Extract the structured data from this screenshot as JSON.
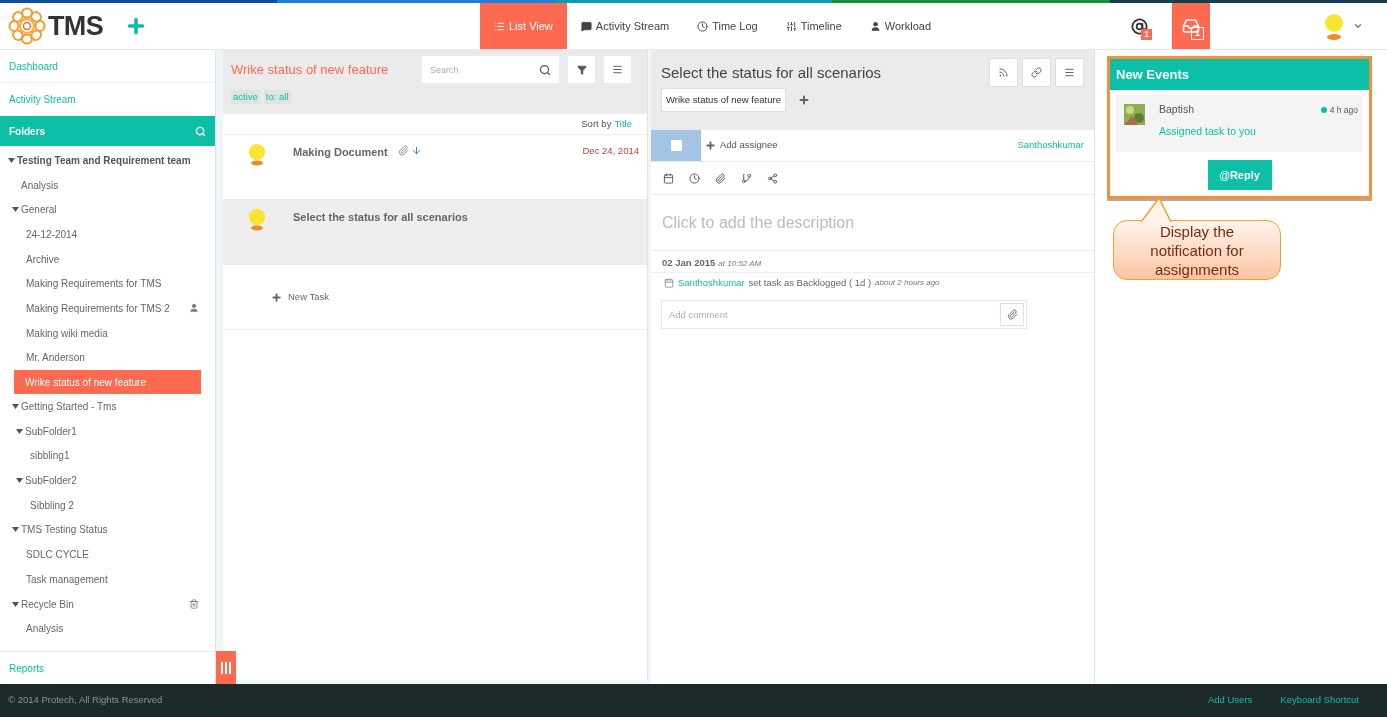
{
  "app": {
    "logo_text": "TMS"
  },
  "nav_tabs": [
    {
      "label": "List View",
      "kind": "list",
      "selected": true
    },
    {
      "label": "Activity Stream",
      "kind": "stream",
      "selected": false
    },
    {
      "label": "Time Log",
      "kind": "time",
      "selected": false
    },
    {
      "label": "Timeline",
      "kind": "timeline",
      "selected": false
    },
    {
      "label": "Workload",
      "kind": "workload",
      "selected": false
    }
  ],
  "notifications": [
    {
      "kind": "mention",
      "count": "1",
      "highlighted": false
    },
    {
      "kind": "inbox",
      "count": "1",
      "highlighted": true
    }
  ],
  "sidebar": {
    "links": [
      "Dashboard",
      "Activity Stream"
    ],
    "folders_title": "Folders",
    "footer_link": "Reports",
    "tree": [
      {
        "label": "Testing Team and Requirement team",
        "selected": false,
        "expanded": true,
        "children": [
          {
            "label": "Analysis",
            "selected": false
          },
          {
            "label": "General",
            "selected": false,
            "expanded": true,
            "children": [
              {
                "label": "24-12-2014",
                "selected": false
              },
              {
                "label": "Archive",
                "selected": false
              },
              {
                "label": "Making Requirements for TMS",
                "selected": false
              },
              {
                "label": "Making Requirements for TMS 2",
                "kind": "shared",
                "selected": false
              },
              {
                "label": "Making wiki media",
                "selected": false
              },
              {
                "label": "Mr. Anderson",
                "selected": false
              },
              {
                "label": "Wrike status of new feature",
                "selected": true
              }
            ]
          },
          {
            "label": "Getting Started - Tms",
            "selected": false,
            "expanded": true,
            "children": [
              {
                "label": "SubFolder1",
                "selected": false,
                "expanded": true,
                "children": [
                  {
                    "label": "sibbling1",
                    "selected": false
                  }
                ]
              },
              {
                "label": "SubFolder2",
                "selected": false,
                "expanded": true,
                "children": [
                  {
                    "label": "Sibbling 2",
                    "selected": false
                  }
                ]
              }
            ]
          },
          {
            "label": "TMS Testing Status",
            "selected": false,
            "expanded": true,
            "children": [
              {
                "label": "SDLC CYCLE",
                "selected": false
              },
              {
                "label": "Task management",
                "selected": false
              }
            ]
          },
          {
            "label": "Recycle Bin",
            "kind": "trash",
            "selected": false,
            "expanded": true,
            "children": [
              {
                "label": "Analysis",
                "selected": false
              }
            ]
          }
        ]
      }
    ]
  },
  "task_list": {
    "title": "Wrike status of new feature",
    "search": {
      "placeholder": "Search"
    },
    "filters": [
      "active",
      "to: all"
    ],
    "sort_label": "Sort by",
    "sort_value": "Title",
    "tasks": [
      {
        "title": "Making Document",
        "date": "Dec 24, 2014",
        "has_attachment": true,
        "selected": false
      },
      {
        "title": "Select the status for all scenarios",
        "has_attachment": false,
        "selected": true
      }
    ],
    "new_task": "New Task"
  },
  "task_detail": {
    "title": "Select the status for all scenarios",
    "folder_tag": "Wrike status of new feature",
    "checked": false,
    "assignee_action": "Add assignee",
    "owner": "Santhoshkumar",
    "description_placeholder": "Click to add the description",
    "log": {
      "date": "02 Jan 2015",
      "time": "at 10:52 AM",
      "user": "Santhoshkumar",
      "action": "set task as Backlogged ( 1d )",
      "ago": "about 2 hours ago"
    },
    "comment": {
      "placeholder": "Add comment"
    }
  },
  "events_panel": {
    "title": "New Events",
    "events": [
      {
        "user": "Baptish",
        "time": "4 h ago",
        "message": "Assigned task to you"
      }
    ],
    "reply_button": "@Reply"
  },
  "callout": "Display the notification for assignments",
  "footer": {
    "copyright": "© 2014 Protech, All Rights Reserved",
    "links": [
      "Add Users",
      "Keyboard Shortcut"
    ]
  }
}
